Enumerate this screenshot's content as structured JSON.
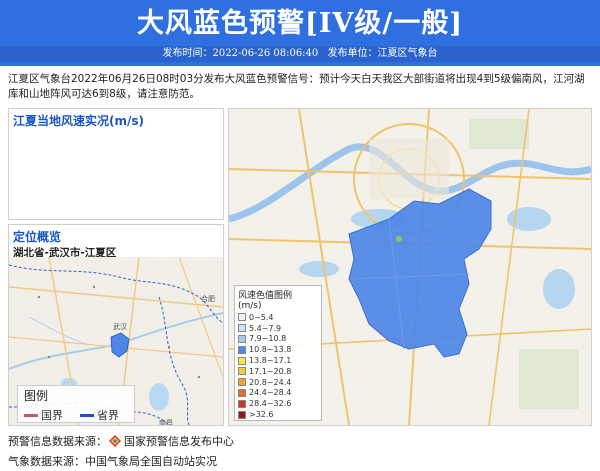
{
  "header": {
    "title": "大风蓝色预警[IV级/一般]",
    "publish_time": "发布时间：2022-06-26 08:06:40",
    "publisher": "发布单位：江夏区气象台"
  },
  "description": "江夏区气象台2022年06月26日08时03分发布大风蓝色预警信号：预计今天白天我区大部街道将出现4到5级偏南风，江河湖库和山地阵风可达6到8级，请注意防范。",
  "wind_panel": {
    "title": "江夏当地风速实况(m/s)"
  },
  "location_panel": {
    "title": "定位概览",
    "subtitle": "湖北省-武汉市-江夏区",
    "place_labels": [
      "合肥",
      "武汉",
      "南昌"
    ],
    "legend": {
      "title": "图例",
      "items": [
        {
          "label": "国界",
          "color": "#c05a6a"
        },
        {
          "label": "省界",
          "color": "#1f4fd0"
        }
      ]
    }
  },
  "map_legend": {
    "title": "风速色值图例 (m/s)",
    "items": [
      {
        "label": "0~5.4",
        "color": "#eef3fb"
      },
      {
        "label": "5.4~7.9",
        "color": "#cfe0f7"
      },
      {
        "label": "7.9~10.8",
        "color": "#a9c8f2"
      },
      {
        "label": "10.8~13.8",
        "color": "#4d86e6"
      },
      {
        "label": "13.8~17.1",
        "color": "#f5e93a"
      },
      {
        "label": "17.1~20.8",
        "color": "#f6cd3d"
      },
      {
        "label": "20.8~24.4",
        "color": "#f3a332"
      },
      {
        "label": "24.4~28.4",
        "color": "#ee6a27"
      },
      {
        "label": "28.4~32.6",
        "color": "#d9311f"
      },
      {
        "label": ">32.6",
        "color": "#9c1515"
      }
    ]
  },
  "footer": {
    "warning_source_label": "预警信息数据来源：",
    "warning_source": "国家预警信息发布中心",
    "weather_source": "气象数据来源：中国气象局全国自动站实况"
  },
  "colors": {
    "header_blue": "#2f6fe0",
    "district_fill": "#4d86e6",
    "accent_title": "#1a55c8"
  }
}
